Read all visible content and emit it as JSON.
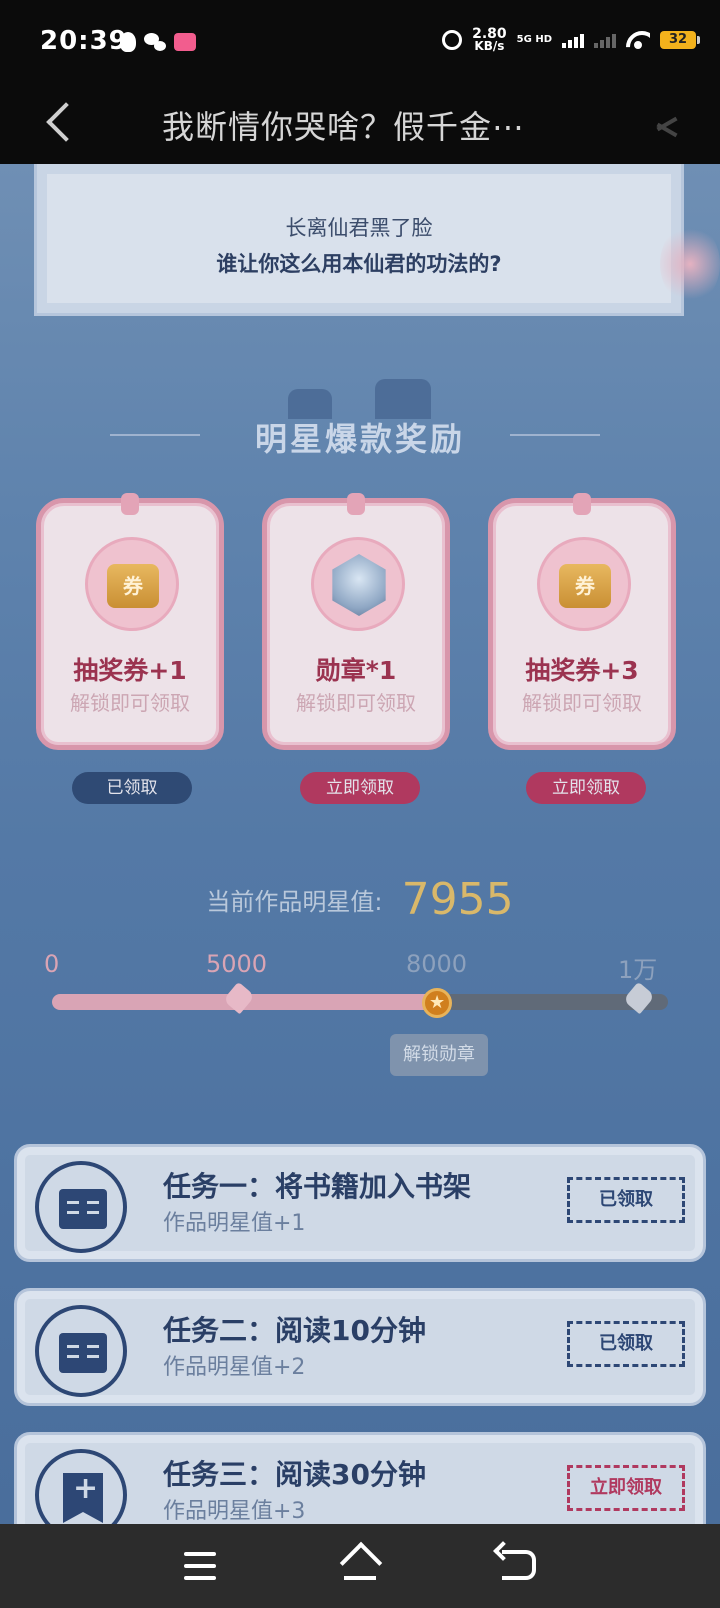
{
  "status_bar": {
    "time": "20:39",
    "net_speed_value": "2.80",
    "net_speed_unit": "KB/s",
    "network_type": "5G HD",
    "battery": "32"
  },
  "header": {
    "title": "我断情你哭啥？假千金⋯"
  },
  "story": {
    "line1": "长离仙君黑了脸",
    "line2": "谁让你这么用本仙君的功法的?"
  },
  "rewards_section": {
    "title": "明星爆款奖励",
    "ticket_glyph": "券",
    "items": [
      {
        "name": "抽奖券+1",
        "sub": "解锁即可领取",
        "button": "已领取"
      },
      {
        "name": "勋章*1",
        "sub": "解锁即可领取",
        "button": "立即领取"
      },
      {
        "name": "抽奖券+3",
        "sub": "解锁即可领取",
        "button": "立即领取"
      }
    ]
  },
  "star_value": {
    "label": "当前作品明星值:",
    "value": "7955",
    "ticks": [
      "0",
      "5000",
      "8000",
      "1万"
    ],
    "progress_fraction": 0.6243,
    "tip": "解锁勋章"
  },
  "tasks": [
    {
      "title": "任务一：将书籍加入书架",
      "sub": "作品明星值+1",
      "button": "已领取"
    },
    {
      "title": "任务二：阅读10分钟",
      "sub": "作品明星值+2",
      "button": "已领取"
    },
    {
      "title": "任务三：阅读30分钟",
      "sub": "作品明星值+3",
      "button": "立即领取"
    }
  ],
  "colors": {
    "accent_pink": "#b0395f",
    "navy": "#2d4775",
    "gold": "#d9b86a"
  }
}
